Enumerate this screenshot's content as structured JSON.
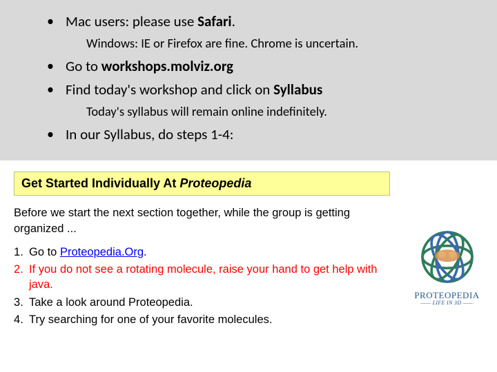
{
  "top": {
    "bullets": [
      {
        "pre": "Mac users: please use ",
        "bold": "Safari",
        "post": "."
      },
      {
        "pre": "Go to ",
        "bold": "workshops.molviz.org",
        "post": ""
      },
      {
        "pre": "Find today's workshop and click on ",
        "bold": "Syllabus",
        "post": ""
      },
      {
        "pre": "In our Syllabus, do steps 1-4:",
        "bold": "",
        "post": ""
      }
    ],
    "sub1": "Windows: IE or Firefox are fine. Chrome is uncertain.",
    "sub2": "Today's syllabus will remain online indefinitely."
  },
  "box": {
    "pre": "Get Started Individually At ",
    "italic": "Proteopedia"
  },
  "intro": "Before we start the next section together, while the group is getting organized ...",
  "steps": {
    "s1_pre": "Go to ",
    "s1_link": "Proteopedia.Org",
    "s1_post": ".",
    "s2": "If you do not see a rotating molecule, raise your hand to get help with java.",
    "s3": "Take a look around Proteopedia.",
    "s4": "Try searching for one of your favorite molecules."
  },
  "logo": {
    "name": "PROTEOPEDIA",
    "tag": "LIFE IN 3D"
  }
}
